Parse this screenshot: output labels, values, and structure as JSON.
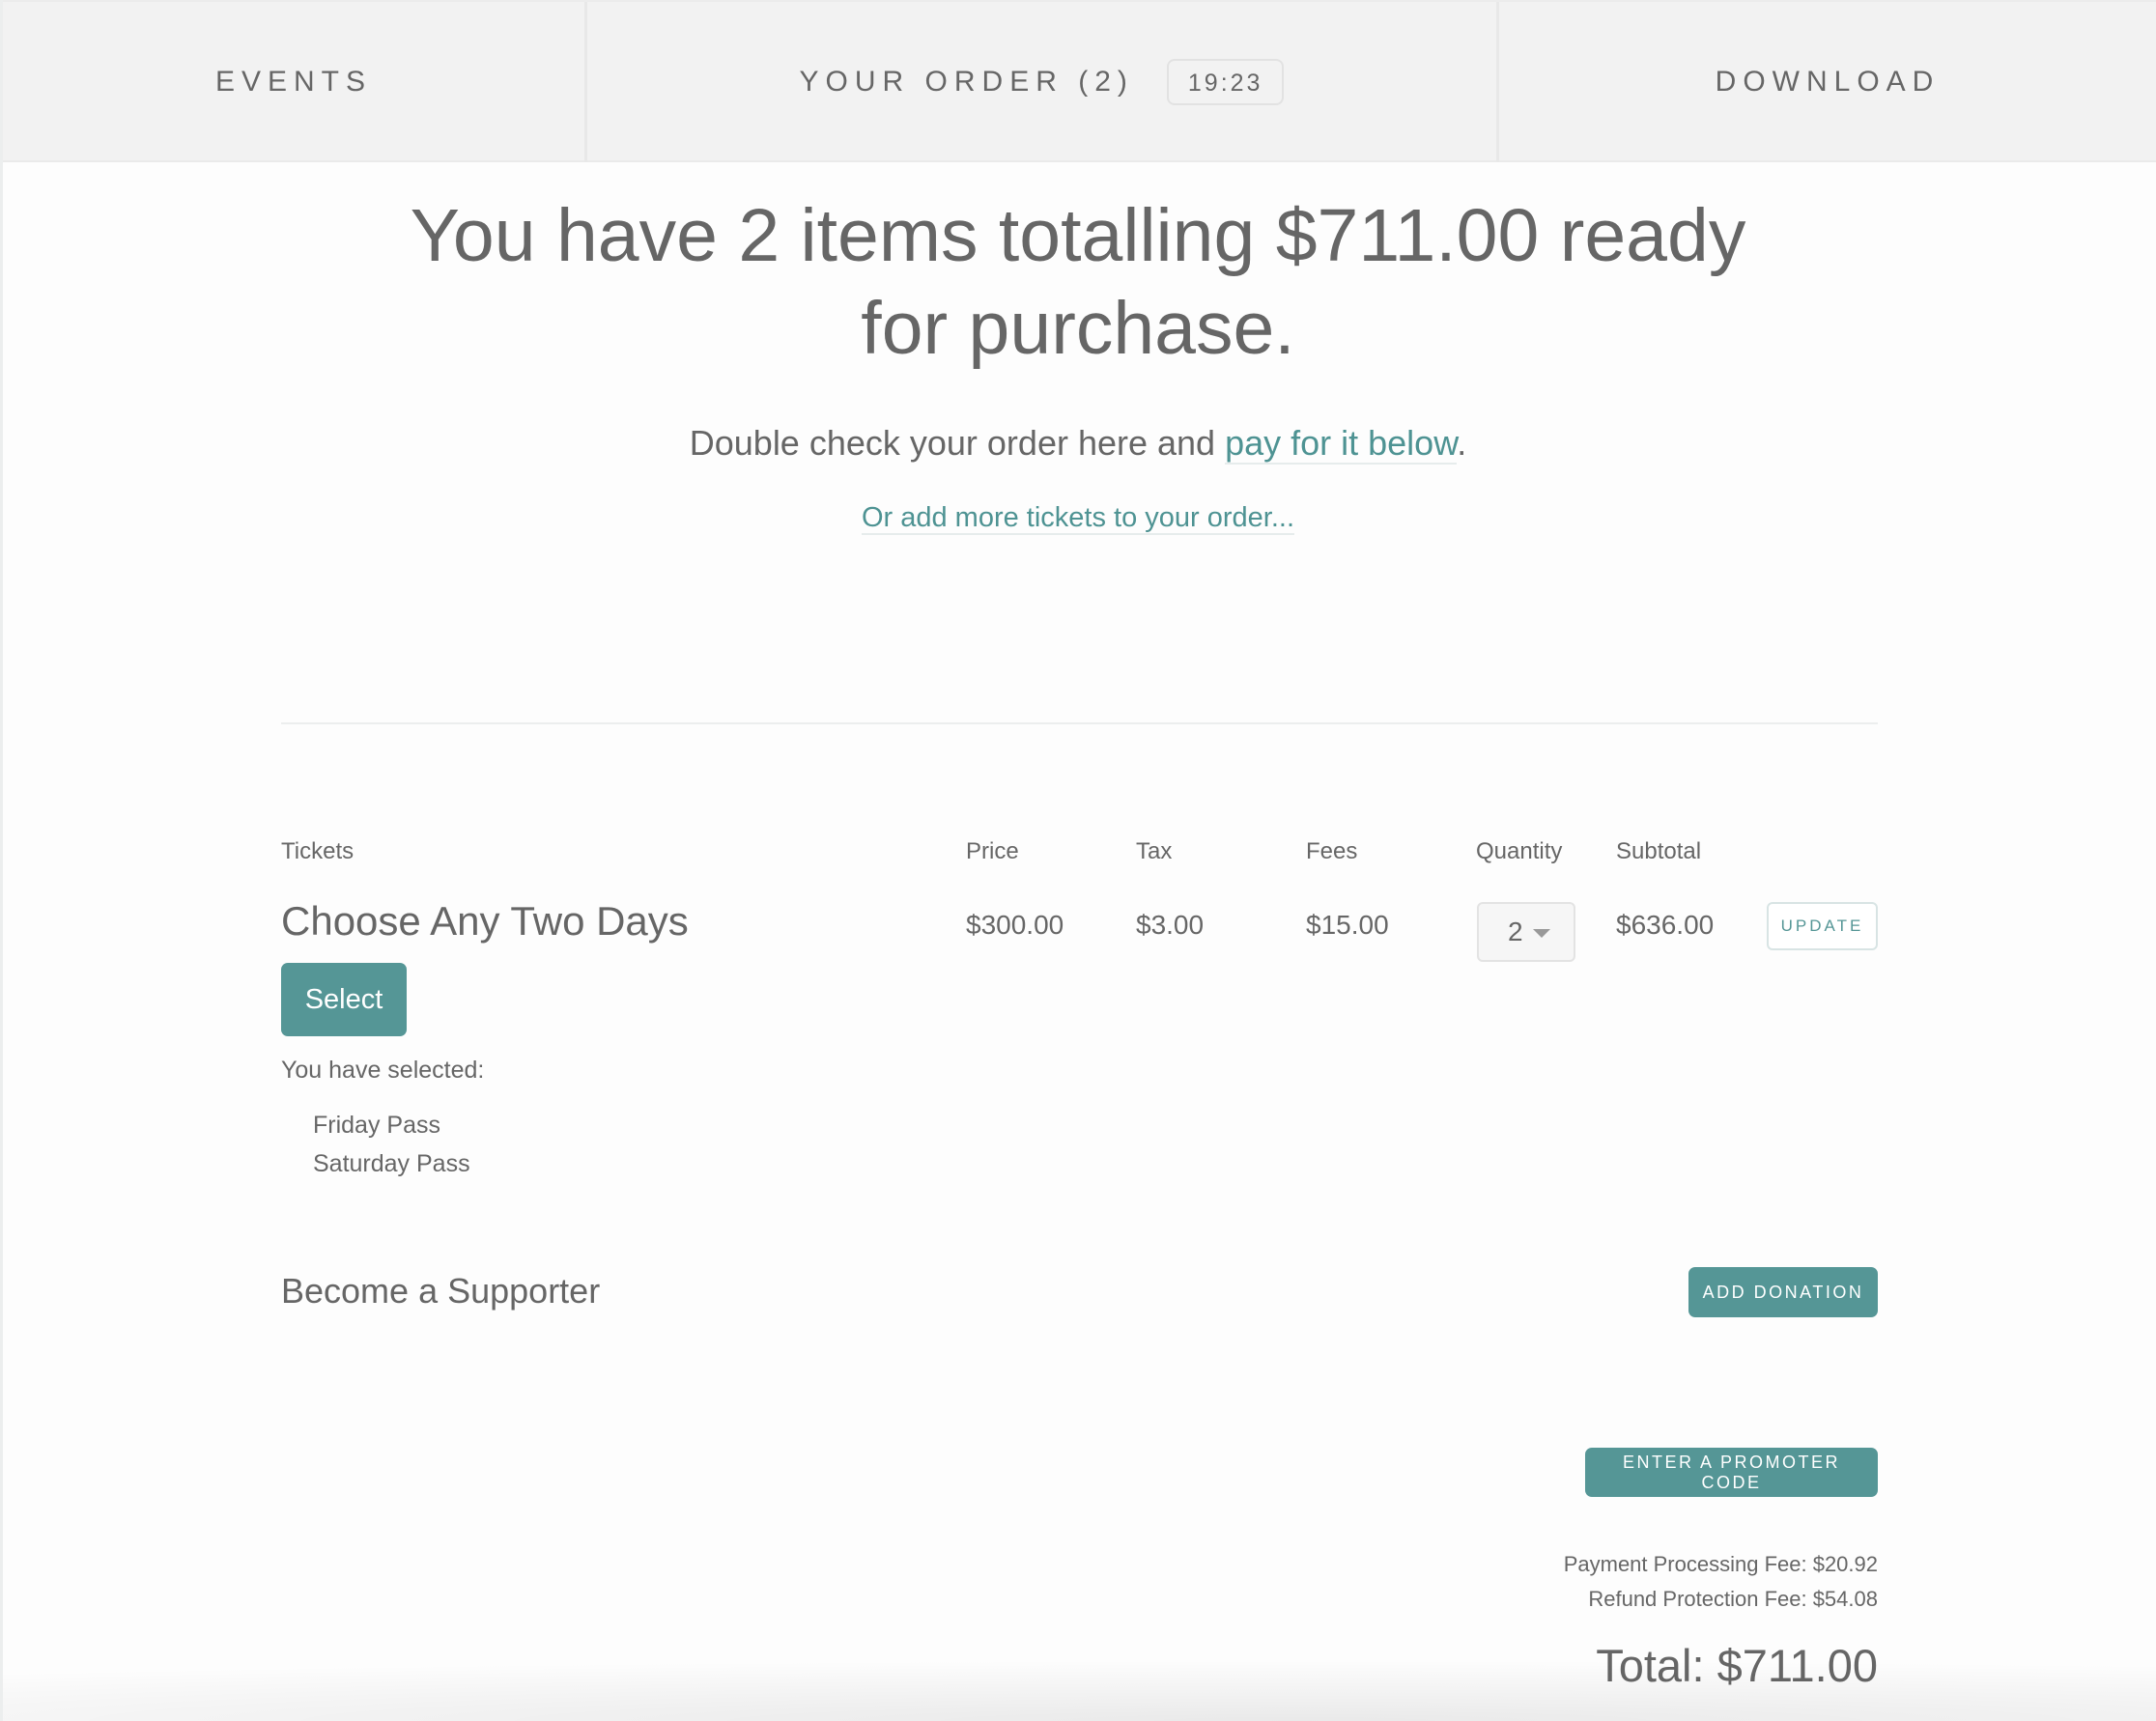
{
  "nav": {
    "events": "Events",
    "order": "Your Order (2)",
    "timer": "19:23",
    "download": "Download"
  },
  "hero": {
    "headline_line1": "You have 2 items totalling $711.00 ready",
    "headline_line2": "for purchase.",
    "subline_prefix": "Double check your order here and ",
    "subline_link": "pay for it below",
    "subline_suffix": ".",
    "add_more_link": "Or add more tickets to your order..."
  },
  "table": {
    "headers": {
      "tickets": "Tickets",
      "price": "Price",
      "tax": "Tax",
      "fees": "Fees",
      "quantity": "Quantity",
      "subtotal": "Subtotal"
    },
    "row": {
      "name": "Choose Any Two Days",
      "price": "$300.00",
      "tax": "$3.00",
      "fees": "$15.00",
      "quantity": "2",
      "subtotal": "$636.00",
      "update_label": "UPDATE",
      "select_label": "Select",
      "selected_label": "You have selected:",
      "selected_items": [
        "Friday Pass",
        "Saturday Pass"
      ]
    }
  },
  "supporter": {
    "title": "Become a Supporter",
    "button": "ADD DONATION"
  },
  "promo": {
    "button": "ENTER A PROMOTER CODE"
  },
  "summary": {
    "processing_fee": "Payment Processing Fee: $20.92",
    "refund_fee": "Refund Protection Fee: $54.08",
    "total": "Total: $711.00"
  },
  "colors": {
    "accent": "#559696",
    "text": "#666666",
    "nav_bg": "#f2f2f2"
  }
}
